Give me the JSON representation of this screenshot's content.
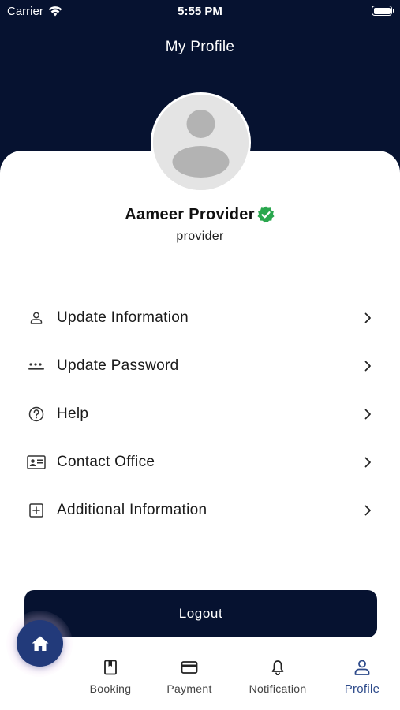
{
  "status_bar": {
    "carrier": "Carrier",
    "time": "5:55 PM"
  },
  "header": {
    "title": "My Profile"
  },
  "profile": {
    "name": "Aameer Provider",
    "role": "provider",
    "verified_color": "#2aa74e"
  },
  "menu": {
    "items": [
      {
        "label": "Update Information",
        "icon": "user-outline-icon"
      },
      {
        "label": "Update Password",
        "icon": "password-dots-icon"
      },
      {
        "label": "Help",
        "icon": "help-circle-icon"
      },
      {
        "label": "Contact Office",
        "icon": "contact-card-icon"
      },
      {
        "label": "Additional Information",
        "icon": "plus-square-icon"
      }
    ]
  },
  "logout": {
    "label": "Logout"
  },
  "tabbar": {
    "home_icon": "home-icon",
    "tabs": [
      {
        "label": "Booking",
        "icon": "book-icon",
        "active": false
      },
      {
        "label": "Payment",
        "icon": "card-icon",
        "active": false
      },
      {
        "label": "Notification",
        "icon": "bell-icon",
        "active": false
      },
      {
        "label": "Profile",
        "icon": "person-icon",
        "active": true
      }
    ]
  },
  "colors": {
    "primary_dark": "#061230",
    "accent": "#223a7a",
    "active_tab": "#2d4a8a"
  }
}
